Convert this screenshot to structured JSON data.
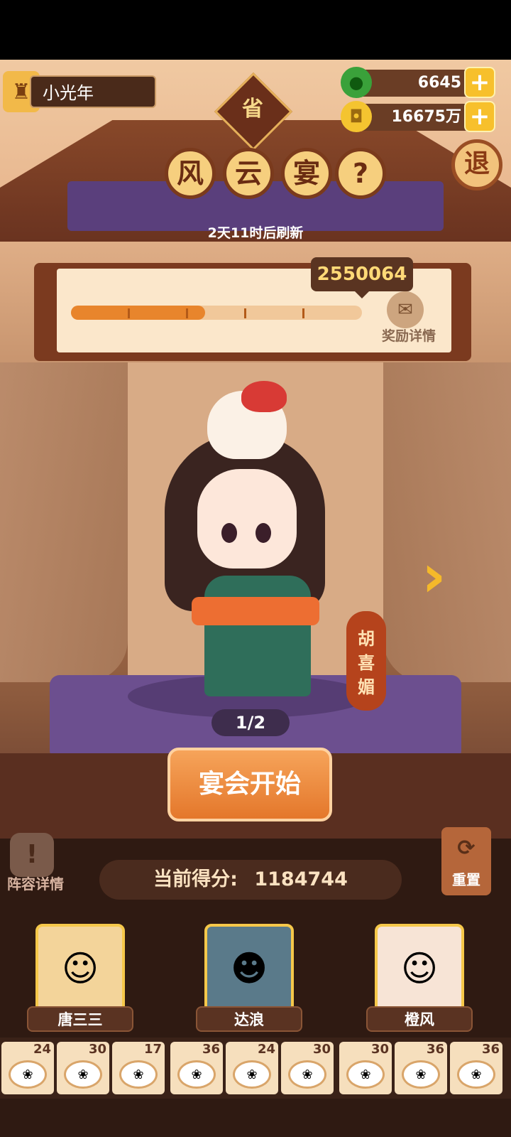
{
  "player": {
    "name": "小光年"
  },
  "currency": {
    "jade": {
      "value": "6645",
      "icon": "jade-icon"
    },
    "gold": {
      "value": "16675万",
      "icon": "coin-icon"
    }
  },
  "province_badge": "省",
  "title_chars": [
    "风",
    "云",
    "宴"
  ],
  "help_label": "?",
  "exit_label": "退",
  "refresh_text": "2天11时后刷新",
  "reward": {
    "target_score": "2550064",
    "progress_fraction": 0.46,
    "details_label": "奖励详情"
  },
  "character": {
    "name_chars": [
      "胡",
      "喜",
      "媚"
    ],
    "page_indicator": "1/2"
  },
  "start_button": "宴会开始",
  "lineup_label": "阵容详情",
  "score": {
    "label": "当前得分:",
    "value": "1184744"
  },
  "reset_label": "重置",
  "team": [
    {
      "name": "唐三三"
    },
    {
      "name": "达浪"
    },
    {
      "name": "橙风"
    }
  ],
  "dishes": [
    {
      "count": "24"
    },
    {
      "count": "30"
    },
    {
      "count": "17"
    },
    {
      "count": "36"
    },
    {
      "count": "24"
    },
    {
      "count": "30"
    },
    {
      "count": "30"
    },
    {
      "count": "36"
    },
    {
      "count": "36"
    }
  ],
  "colors": {
    "accent": "#e8852c",
    "gold": "#f7c02c",
    "stage": "#6c4f8f"
  }
}
